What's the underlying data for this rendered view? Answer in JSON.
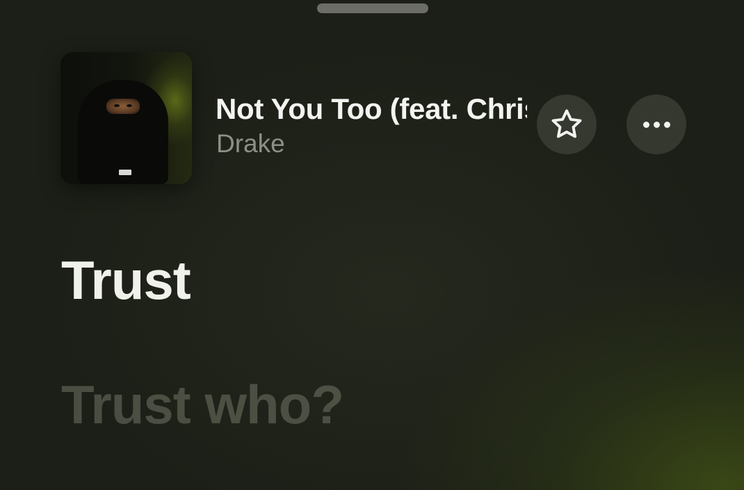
{
  "now_playing": {
    "title": "Not You Too (feat. Chris Brown)",
    "artist": "Drake",
    "artwork_icon": "album-artwork-image"
  },
  "actions": {
    "favorite_icon": "star-outline-icon",
    "more_icon": "ellipsis-icon"
  },
  "lyrics": {
    "lines": [
      {
        "text": "Trust",
        "state": "active"
      },
      {
        "text": "Trust who?",
        "state": "upcoming"
      }
    ]
  },
  "colors": {
    "background": "#1c1f17",
    "accent_glow": "#3e4e16",
    "active_lyric": "#f1f1ec",
    "artist_text": "#8e8f88"
  }
}
